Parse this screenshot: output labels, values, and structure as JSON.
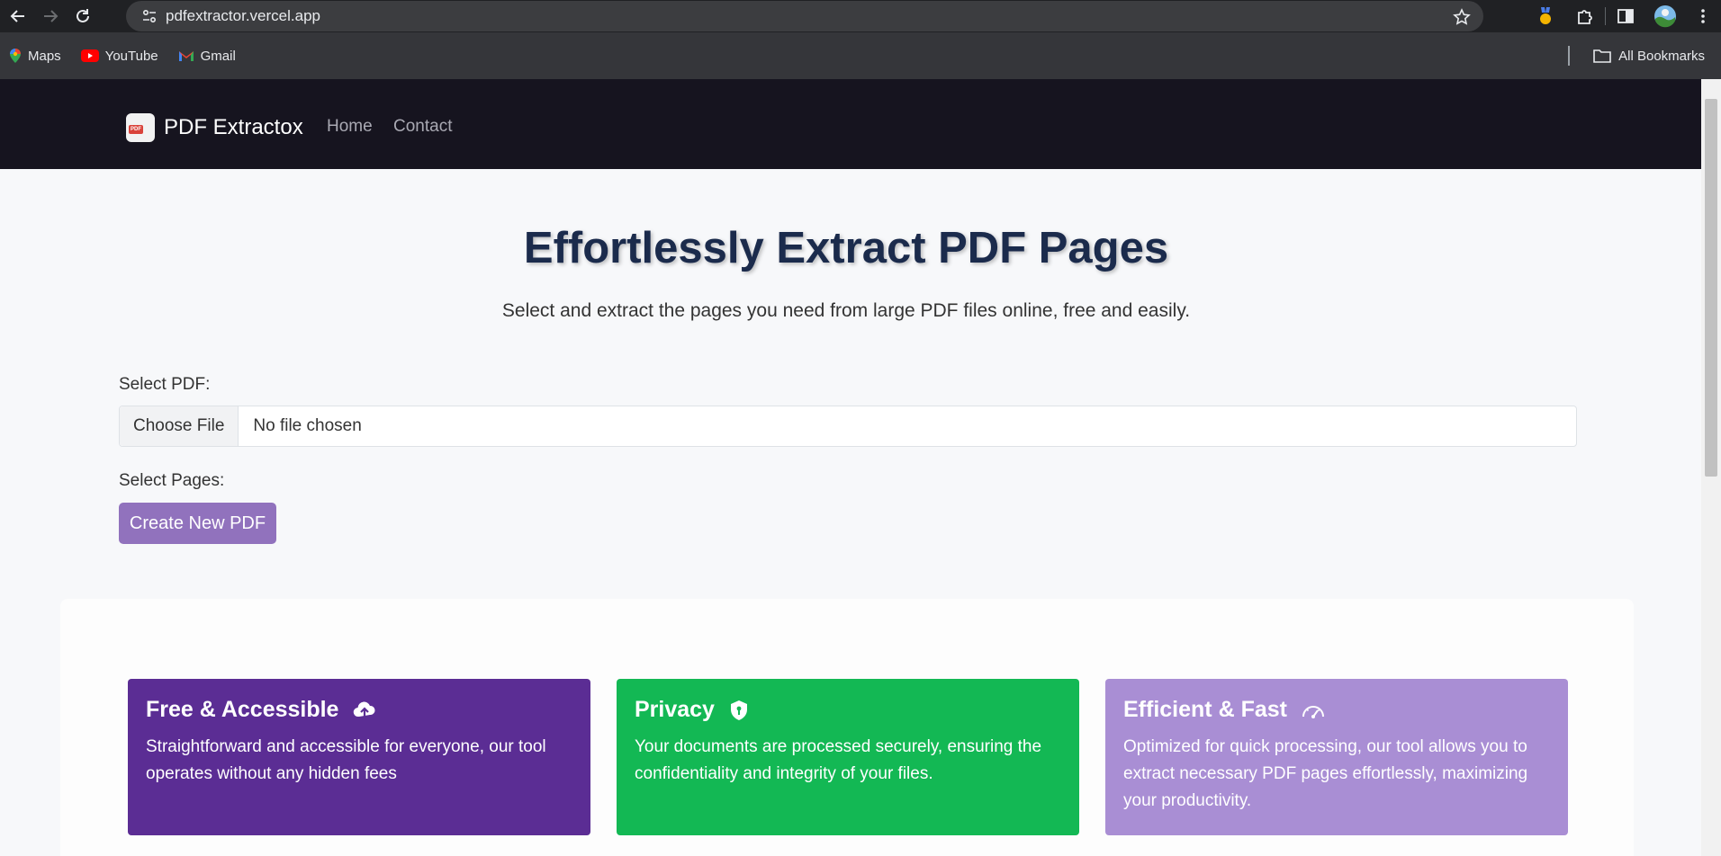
{
  "browser": {
    "url": "pdfextractor.vercel.app",
    "bookmarks": [
      {
        "label": "Maps",
        "icon": "maps-pin-icon"
      },
      {
        "label": "YouTube",
        "icon": "youtube-icon"
      },
      {
        "label": "Gmail",
        "icon": "gmail-icon"
      }
    ],
    "all_bookmarks": "All Bookmarks"
  },
  "navbar": {
    "brand": "PDF Extractox",
    "links": [
      "Home",
      "Contact"
    ],
    "background": "#16141f"
  },
  "hero": {
    "title": "Effortlessly Extract PDF Pages",
    "subtitle": "Select and extract the pages you need from large PDF files online, free and easily."
  },
  "form": {
    "select_pdf_label": "Select PDF:",
    "choose_file": "Choose File",
    "file_status": "No file chosen",
    "select_pages_label": "Select Pages:",
    "create_button": "Create New PDF",
    "button_color": "#9172bd"
  },
  "features": [
    {
      "title": "Free & Accessible",
      "icon": "cloud-upload-icon",
      "text": "Straightforward and accessible for everyone, our tool operates without any hidden fees",
      "color": "#5b2d94"
    },
    {
      "title": "Privacy",
      "icon": "shield-icon",
      "text": "Your documents are processed securely, ensuring the confidentiality and integrity of your files.",
      "color": "#13b854"
    },
    {
      "title": "Efficient & Fast",
      "icon": "speedometer-icon",
      "text": "Optimized for quick processing, our tool allows you to extract necessary PDF pages effortlessly, maximizing your productivity.",
      "color": "#a98ed4"
    }
  ]
}
